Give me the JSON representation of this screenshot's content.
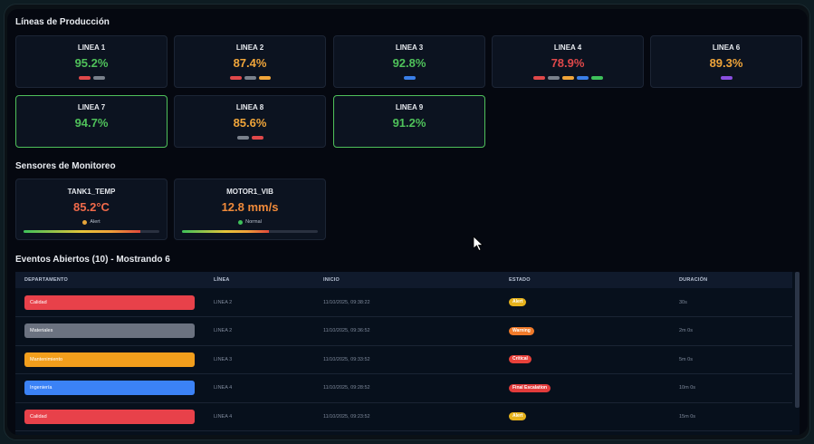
{
  "production": {
    "title": "Líneas de Producción",
    "lines": [
      {
        "name": "LINEA 1",
        "value": "95.2%",
        "color": "#4fc15a",
        "dots": [
          "#e0484a",
          "#7a818c"
        ],
        "highlight": false
      },
      {
        "name": "LINEA 2",
        "value": "87.4%",
        "color": "#f0a53a",
        "dots": [
          "#e0484a",
          "#7a818c",
          "#f0a53a"
        ],
        "highlight": false
      },
      {
        "name": "LINEA 3",
        "value": "92.8%",
        "color": "#4fc15a",
        "dots": [
          "#3a7fe8"
        ],
        "highlight": false
      },
      {
        "name": "LINEA 4",
        "value": "78.9%",
        "color": "#e0484a",
        "dots": [
          "#e0484a",
          "#7a818c",
          "#f0a53a",
          "#3a7fe8",
          "#3ec15a"
        ],
        "highlight": false
      },
      {
        "name": "LINEA 6",
        "value": "89.3%",
        "color": "#f0a53a",
        "dots": [
          "#8a4fe0"
        ],
        "highlight": false
      },
      {
        "name": "LINEA 7",
        "value": "94.7%",
        "color": "#4fc15a",
        "dots": [],
        "highlight": true
      },
      {
        "name": "LINEA 8",
        "value": "85.6%",
        "color": "#f0a53a",
        "dots": [
          "#7a818c",
          "#e0484a"
        ],
        "highlight": false
      },
      {
        "name": "LINEA 9",
        "value": "91.2%",
        "color": "#4fc15a",
        "dots": [],
        "highlight": true
      }
    ]
  },
  "sensors": {
    "title": "Sensores de Monitoreo",
    "items": [
      {
        "name": "TANK1_TEMP",
        "value": "85.2°C",
        "color": "#f06a4a",
        "status": "Alert",
        "status_color": "#e6a53a",
        "level": 0.86
      },
      {
        "name": "MOTOR1_VIB",
        "value": "12.8 mm/s",
        "color": "#f08a3a",
        "status": "Normal",
        "status_color": "#3ec15a",
        "level": 0.64
      }
    ]
  },
  "events": {
    "title": "Eventos Abiertos (10) - Mostrando 6",
    "columns": [
      "DEPARTAMENTO",
      "LÍNEA",
      "INICIO",
      "ESTADO",
      "DURACIÓN"
    ],
    "rows": [
      {
        "department": "Calidad",
        "dept_color": "#e8414a",
        "line": "LINEA 2",
        "start": "11/10/2025, 09:38:22",
        "status": "Alert",
        "status_color": "#e6b21c",
        "duration": "30s"
      },
      {
        "department": "Materiales",
        "dept_color": "#6b7280",
        "line": "LINEA 2",
        "start": "11/10/2025, 09:36:52",
        "status": "Warning",
        "status_color": "#f07a2a",
        "duration": "2m 0s"
      },
      {
        "department": "Mantenimiento",
        "dept_color": "#f29e1c",
        "line": "LINEA 3",
        "start": "11/10/2025, 09:33:52",
        "status": "Critical",
        "status_color": "#e8413a",
        "duration": "5m 0s"
      },
      {
        "department": "Ingeniería",
        "dept_color": "#3b82f6",
        "line": "LINEA 4",
        "start": "11/10/2025, 09:28:52",
        "status": "Final Escalation",
        "status_color": "#e23b3b",
        "duration": "10m 0s"
      },
      {
        "department": "Calidad",
        "dept_color": "#e8414a",
        "line": "LINEA 4",
        "start": "11/10/2025, 09:23:52",
        "status": "Alert",
        "status_color": "#e6b21c",
        "duration": "15m 0s"
      }
    ]
  }
}
